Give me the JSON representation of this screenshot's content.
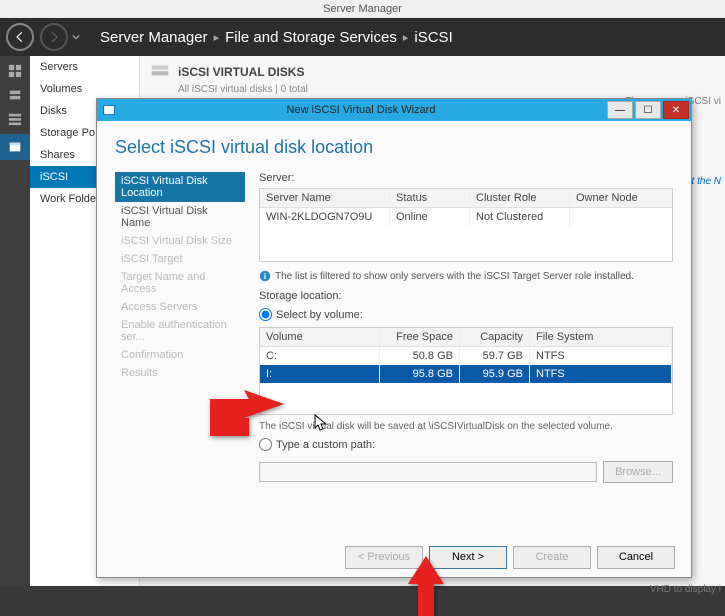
{
  "app_title": "Server Manager",
  "breadcrumb": {
    "a": "Server Manager",
    "b": "File and Storage Services",
    "c": "iSCSI"
  },
  "nav_items": [
    "Servers",
    "Volumes",
    "Disks",
    "Storage Po",
    "Shares",
    "iSCSI",
    "Work Folders"
  ],
  "nav_selected_index": 5,
  "content": {
    "title": "iSCSI VIRTUAL DISKS",
    "subtitle": "All iSCSI virtual disks | 0 total",
    "err": "There are no iSCSI vi",
    "link": "disk, start the N",
    "vhd": "VHD to display i"
  },
  "wizard": {
    "title": "New iSCSI Virtual Disk Wizard",
    "heading": "Select iSCSI virtual disk location",
    "steps": [
      "iSCSI Virtual Disk Location",
      "iSCSI Virtual Disk Name",
      "iSCSI Virtual Disk Size",
      "iSCSI Target",
      "Target Name and Access",
      "Access Servers",
      "Enable authentication ser...",
      "Confirmation",
      "Results"
    ],
    "current_step_index": 0,
    "server_section_label": "Server:",
    "server_headers": {
      "name": "Server Name",
      "status": "Status",
      "cluster": "Cluster Role",
      "owner": "Owner Node"
    },
    "servers": [
      {
        "name": "WIN-2KLDOGN7O9U",
        "status": "Online",
        "cluster": "Not Clustered",
        "owner": ""
      }
    ],
    "info_note": "The list is filtered to show only servers with the iSCSI Target Server role installed.",
    "storage_label": "Storage location:",
    "radio_volume_label": "Select by volume:",
    "radio_custom_label": "Type a custom path:",
    "vol_headers": {
      "vol": "Volume",
      "free": "Free Space",
      "cap": "Capacity",
      "fs": "File System"
    },
    "volumes": [
      {
        "vol": "C:",
        "free": "50.8 GB",
        "cap": "59.7 GB",
        "fs": "NTFS"
      },
      {
        "vol": "I:",
        "free": "95.8 GB",
        "cap": "95.9 GB",
        "fs": "NTFS"
      }
    ],
    "selected_volume_index": 1,
    "vol_note": "The iSCSI virtual disk will be saved at \\iSCSIVirtualDisk on the selected volume.",
    "browse_label": "Browse...",
    "buttons": {
      "prev": "< Previous",
      "next": "Next >",
      "create": "Create",
      "cancel": "Cancel"
    }
  }
}
